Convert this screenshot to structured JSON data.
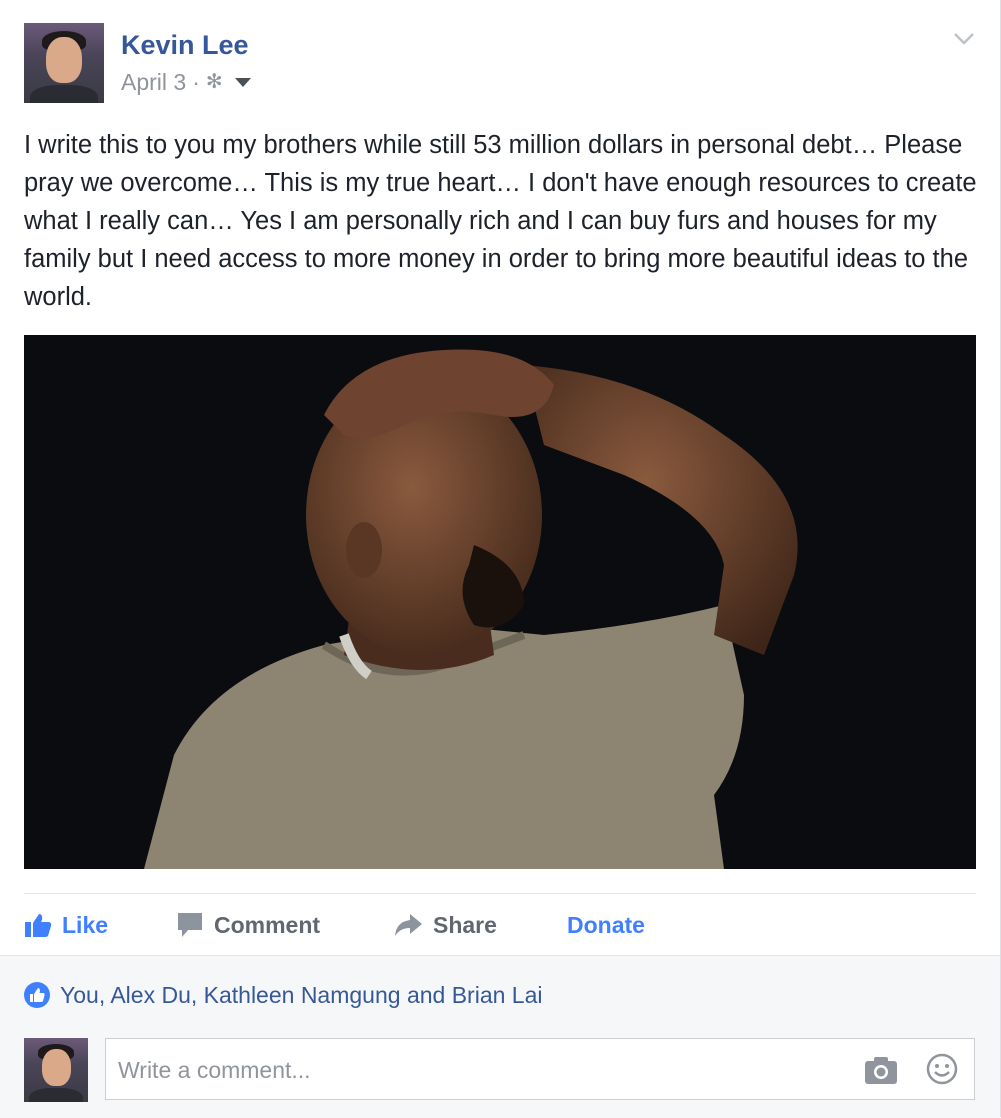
{
  "post": {
    "author": "Kevin Lee",
    "date": "April 3",
    "separator": "·",
    "text": "I write this to you my brothers while still 53 million dollars in personal debt… Please pray we overcome… This is my true heart… I don't have enough resources to create what I really can… Yes I am personally rich and I can buy furs and houses for my family but I need access to more money in order to bring more beautiful ideas to the world."
  },
  "icons": {
    "privacy": "gear-icon",
    "menu": "chevron-down-icon",
    "like": "thumbs-up-icon",
    "comment": "comment-bubble-icon",
    "share": "share-arrow-icon",
    "camera": "camera-icon",
    "emoji": "smiley-icon"
  },
  "actions": {
    "like": "Like",
    "comment": "Comment",
    "share": "Share",
    "donate": "Donate"
  },
  "likes": {
    "summary": "You, Alex Du, Kathleen Namgung and Brian Lai"
  },
  "comment": {
    "placeholder": "Write a comment..."
  },
  "colors": {
    "link": "#365899",
    "accent": "#4080ff",
    "muted": "#90949c",
    "footer_bg": "#f6f7f9"
  }
}
